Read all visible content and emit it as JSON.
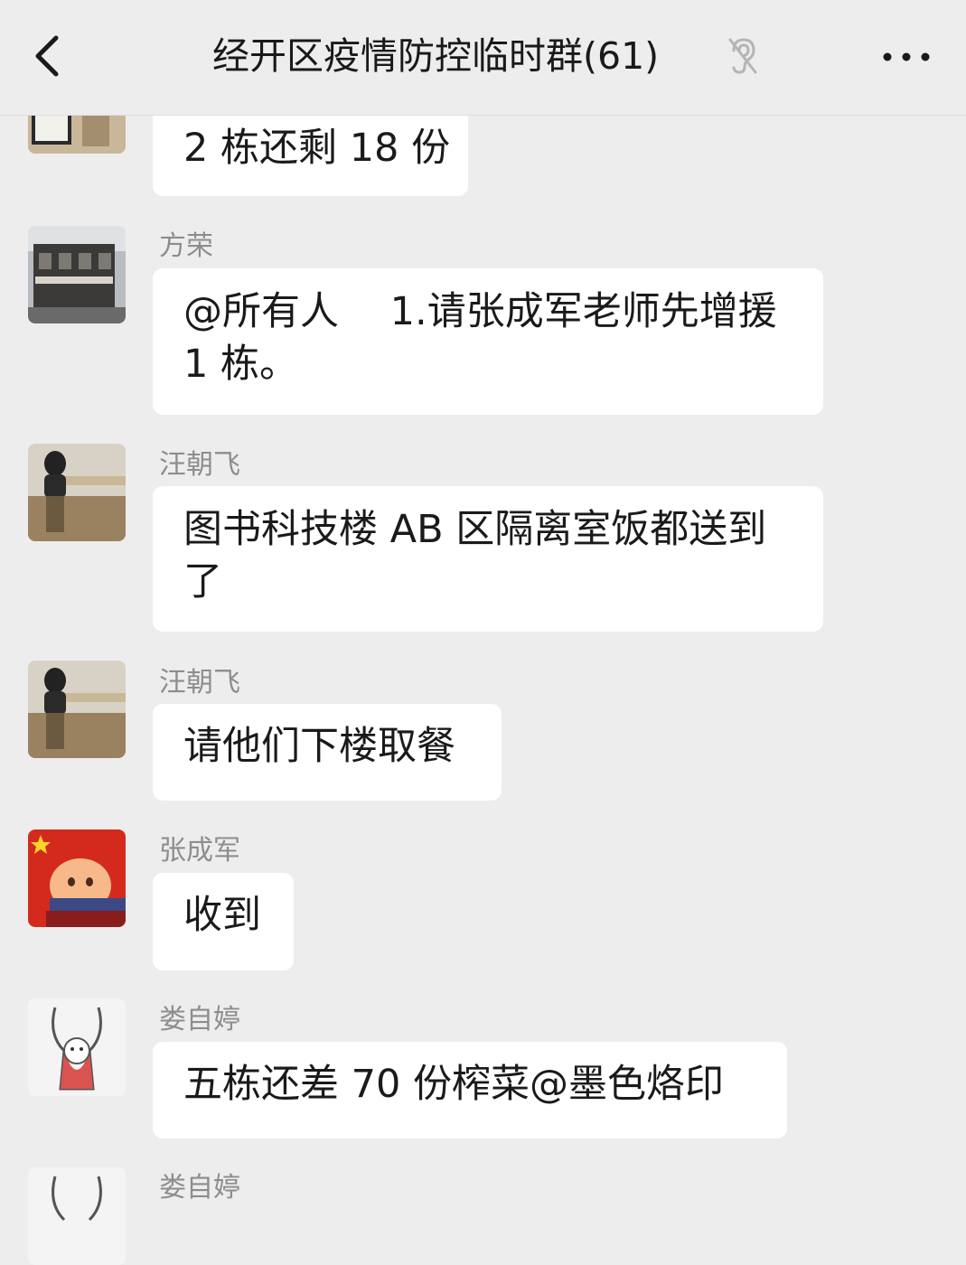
{
  "header": {
    "title": "经开区疫情防控临时群(61)",
    "back_icon": "chevron-left-icon",
    "mute_icon": "ear-mute-icon",
    "more_icon": "more-dots-icon"
  },
  "messages": [
    {
      "sender": "",
      "text": "2 栋还剩 18 份",
      "avatar": "photo-avatar"
    },
    {
      "sender": "方荣",
      "text": "@所有人　 1.请张成军老师先增援 1 栋。",
      "avatar": "building-photo-avatar"
    },
    {
      "sender": "汪朝飞",
      "text": "图书科技楼 AB 区隔离室饭都送到了",
      "avatar": "statue-photo-avatar"
    },
    {
      "sender": "汪朝飞",
      "text": "请他们下楼取餐",
      "avatar": "statue-photo-avatar"
    },
    {
      "sender": "张成军",
      "text": "收到",
      "avatar": "flag-cartoon-avatar"
    },
    {
      "sender": "娄自婷",
      "text": "五栋还差 70 份榨菜@墨色烙印",
      "avatar": "rabbit-cartoon-avatar"
    },
    {
      "sender": "娄自婷",
      "text": "",
      "avatar": "rabbit-cartoon-avatar"
    }
  ],
  "colors": {
    "background": "#ededed",
    "bubble": "#ffffff",
    "sender_name": "#8d8d8d",
    "text": "#1a1a1a"
  }
}
